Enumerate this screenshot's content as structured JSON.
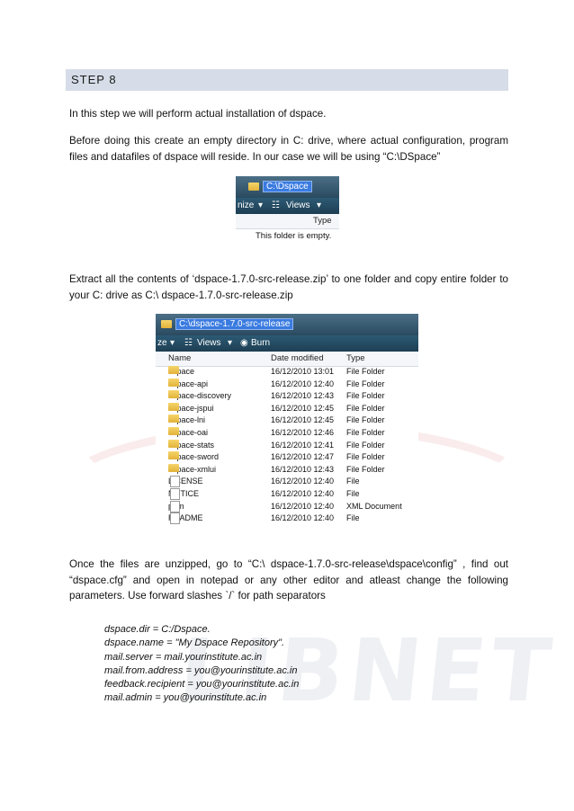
{
  "step": {
    "title": "STEP 8"
  },
  "paragraphs": {
    "p1": "In this step we will perform actual installation of dspace.",
    "p2": "Before doing this create an empty directory in C: drive, where actual configuration, program files  and datafiles of dspace will reside. In our case we will be using “C:\\DSpace”",
    "p3": "Extract all the contents of  ‘dspace-1.7.0-src-release.zip’ to one folder and copy entire folder to your C: drive as C:\\ dspace-1.7.0-src-release.zip",
    "p4": "Once the files are unzipped, go to “C:\\ dspace-1.7.0-src-release\\dspace\\config” , find out “dspace.cfg” and open in notepad  or any other editor and atleast change the following parameters. Use forward slashes `/` for path separators"
  },
  "screenshot1": {
    "address": "C:\\Dspace",
    "organize": "nize",
    "views": "Views",
    "col_type": "Type",
    "empty_msg": "This folder is empty."
  },
  "screenshot2": {
    "address": "C:\\dspace-1.7.0-src-release",
    "organize": "ze",
    "views": "Views",
    "burn": "Burn",
    "columns": {
      "name": "Name",
      "date": "Date modified",
      "type": "Type"
    },
    "rows": [
      {
        "name": "dspace",
        "date": "16/12/2010 13:01",
        "type": "File Folder",
        "icon": "folder"
      },
      {
        "name": "dspace-api",
        "date": "16/12/2010 12:40",
        "type": "File Folder",
        "icon": "folder"
      },
      {
        "name": "dspace-discovery",
        "date": "16/12/2010 12:43",
        "type": "File Folder",
        "icon": "folder"
      },
      {
        "name": "dspace-jspui",
        "date": "16/12/2010 12:45",
        "type": "File Folder",
        "icon": "folder"
      },
      {
        "name": "dspace-lni",
        "date": "16/12/2010 12:45",
        "type": "File Folder",
        "icon": "folder"
      },
      {
        "name": "dspace-oai",
        "date": "16/12/2010 12:46",
        "type": "File Folder",
        "icon": "folder"
      },
      {
        "name": "dspace-stats",
        "date": "16/12/2010 12:41",
        "type": "File Folder",
        "icon": "folder"
      },
      {
        "name": "dspace-sword",
        "date": "16/12/2010 12:47",
        "type": "File Folder",
        "icon": "folder"
      },
      {
        "name": "dspace-xmlui",
        "date": "16/12/2010 12:43",
        "type": "File Folder",
        "icon": "folder"
      },
      {
        "name": "LICENSE",
        "date": "16/12/2010 12:40",
        "type": "File",
        "icon": "file"
      },
      {
        "name": "NOTICE",
        "date": "16/12/2010 12:40",
        "type": "File",
        "icon": "file"
      },
      {
        "name": "pom",
        "date": "16/12/2010 12:40",
        "type": "XML Document",
        "icon": "xml-file"
      },
      {
        "name": "README",
        "date": "16/12/2010 12:40",
        "type": "File",
        "icon": "file"
      }
    ]
  },
  "config_lines": [
    "dspace.dir = C:/Dspace.",
    "dspace.name = \"My Dspace Repository\".",
    "mail.server = mail.yourinstitute.ac.in",
    "mail.from.address = you@yourinstitute.ac.in",
    "feedback.recipient = you@yourinstitute.ac.in",
    "mail.admin = you@yourinstitute.ac.in"
  ],
  "watermark": {
    "text": "LIBNET"
  },
  "colors": {
    "step_bar": "#d6dde8",
    "explorer_bar": "#2d5a75",
    "selection": "#3a7be0"
  }
}
